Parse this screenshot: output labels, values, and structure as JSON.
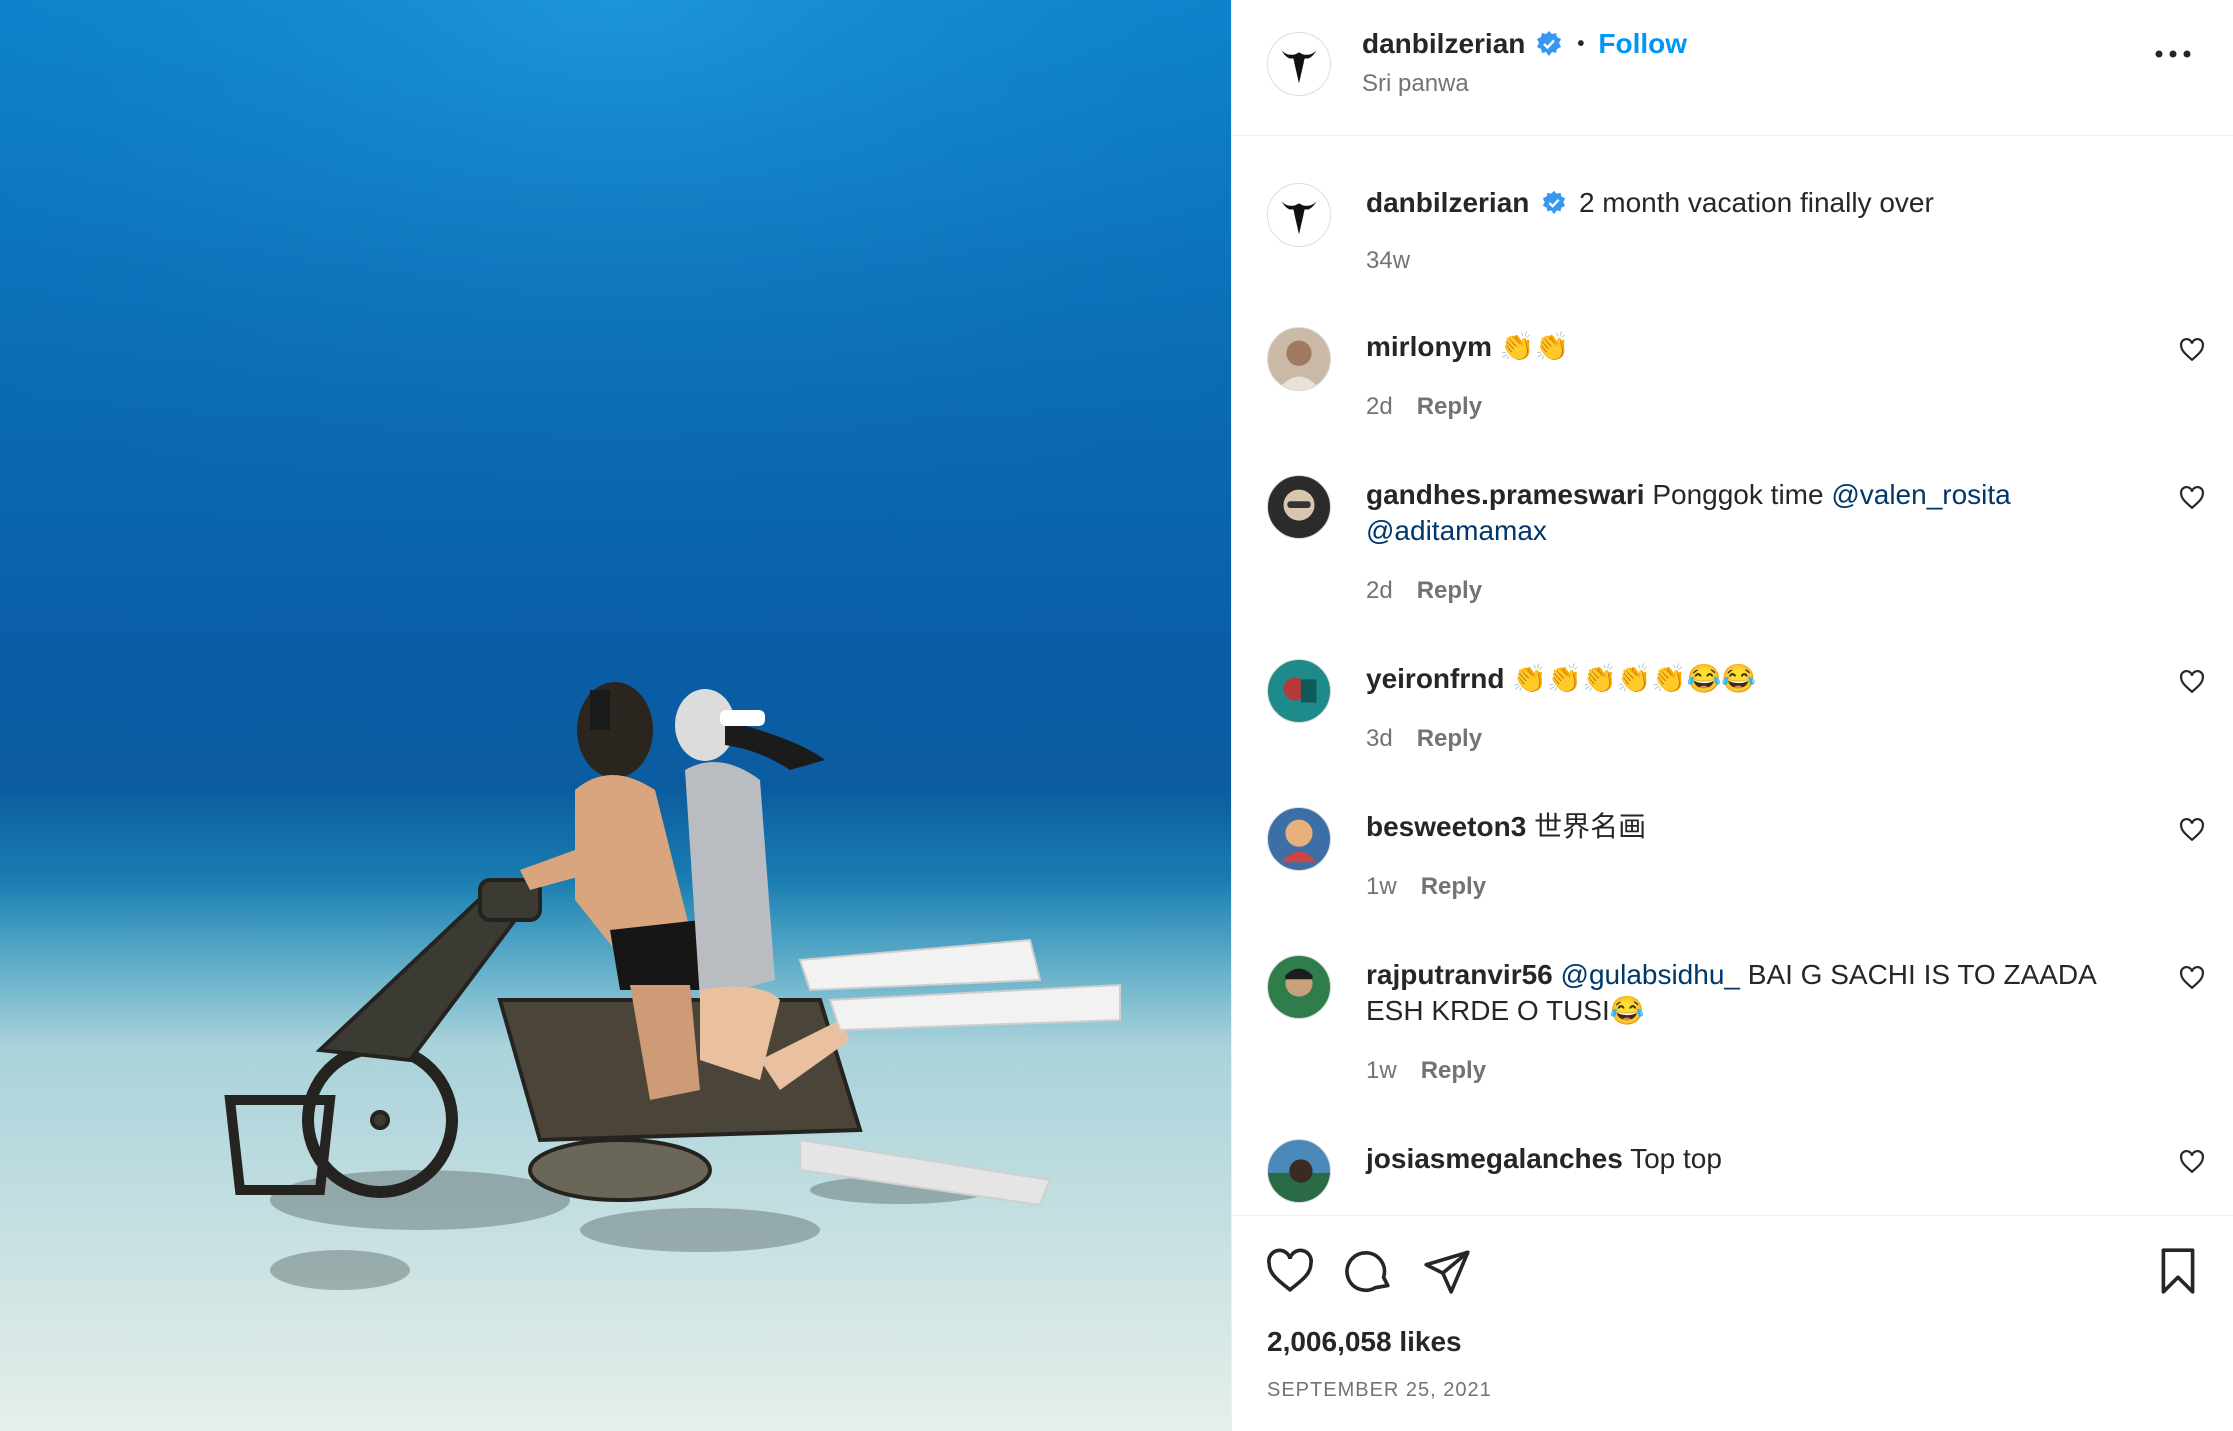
{
  "post": {
    "username": "danbilzerian",
    "follow_label": "Follow",
    "separator": "•",
    "location": "Sri panwa",
    "caption": "2 month vacation finally over",
    "caption_time": "34w",
    "likes": "2,006,058 likes",
    "date": "SEPTEMBER 25, 2021"
  },
  "comments": [
    {
      "user": "mirlonym",
      "text": "👏👏",
      "time": "2d",
      "reply": "Reply",
      "avatar_color": "#c9b9a6"
    },
    {
      "user": "gandhes.prameswari",
      "text": "Ponggok time ",
      "mention1": "@valen_rosita",
      "mention2": "@aditamamax",
      "time": "2d",
      "reply": "Reply",
      "avatar_color": "#2b2b2b"
    },
    {
      "user": "yeironfrnd",
      "text": "👏👏👏👏👏😂😂",
      "time": "3d",
      "reply": "Reply",
      "avatar_color": "#1f8a8a"
    },
    {
      "user": "besweeton3",
      "text": "世界名画",
      "time": "1w",
      "reply": "Reply",
      "avatar_color": "#3b6fa6"
    },
    {
      "user": "rajputranvir56",
      "mention": "@gulabsidhu_",
      "text": " BAI G SACHI IS TO ZAADA ESH KRDE O TUSI😂",
      "time": "1w",
      "reply": "Reply",
      "avatar_color": "#2f7d4a"
    },
    {
      "user": "josiasmegalanches",
      "text": "Top top",
      "avatar_color": "#4a8ab8"
    }
  ],
  "icons": {
    "verified": "verified-badge-icon",
    "more": "more-options-icon",
    "like": "heart-icon",
    "comment": "comment-icon",
    "share": "send-icon",
    "save": "bookmark-icon"
  },
  "colors": {
    "accent": "#0095f6",
    "mention": "#00376b",
    "muted": "#737373",
    "verified": "#3897f0"
  }
}
